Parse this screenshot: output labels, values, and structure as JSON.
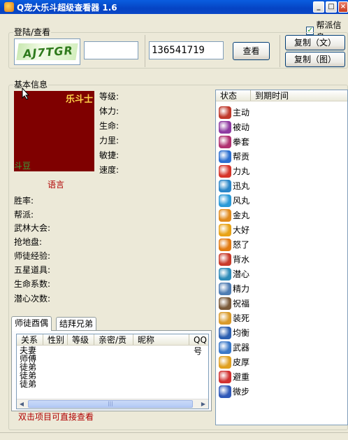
{
  "window": {
    "title": "Q宠大乐斗超级查看器 1.6",
    "min": "_",
    "max": "□",
    "close": "×"
  },
  "guild_toggle": {
    "label": "帮派信息",
    "checked": true
  },
  "login": {
    "group_title": "登陆/查看",
    "captcha_text": "AJ7TGR",
    "qq_input_value": "",
    "target_qq_value": "136541719",
    "view_button": "查看",
    "copy_text_button": "复制（文）",
    "copy_image_button": "复制（图）"
  },
  "basic": {
    "group_title": "基本信息",
    "class_name": "乐斗士",
    "avatar_corner": "斗豆",
    "language_link": "语言",
    "stats": [
      "等级:",
      "体力:",
      "生命:",
      "力里:",
      "敏捷:",
      "速度:"
    ],
    "info": [
      "胜率:",
      "帮派:",
      "武林大会:",
      "抢地盘:",
      "师徒经验:",
      "五星道具:",
      "生命系数:",
      "潜心次数:"
    ]
  },
  "status_list": {
    "headers": [
      "状态",
      "到期时间"
    ],
    "items": [
      {
        "label": "主动",
        "icon": "active-icon",
        "color": "#c0392b"
      },
      {
        "label": "被动",
        "icon": "passive-icon",
        "color": "#8e3aa1"
      },
      {
        "label": "拳套",
        "icon": "glove-icon",
        "color": "#b03070"
      },
      {
        "label": "帮贡",
        "icon": "guild-contribution-icon",
        "color": "#2b6fd0"
      },
      {
        "label": "力丸",
        "icon": "strength-pill-icon",
        "color": "#d6352a"
      },
      {
        "label": "迅丸",
        "icon": "speed-pill-icon",
        "color": "#2a86c8"
      },
      {
        "label": "风丸",
        "icon": "wind-pill-icon",
        "color": "#2a9ad8"
      },
      {
        "label": "金丸",
        "icon": "gold-pill-icon",
        "color": "#e08a1c"
      },
      {
        "label": "大好",
        "icon": "great-icon",
        "color": "#e8a317"
      },
      {
        "label": "怒了",
        "icon": "angry-icon",
        "color": "#e27b12"
      },
      {
        "label": "背水",
        "icon": "backwater-icon",
        "color": "#c83a2a"
      },
      {
        "label": "潜心",
        "icon": "meditate-icon",
        "color": "#2d8bb8"
      },
      {
        "label": "精力",
        "icon": "energy-icon",
        "color": "#4f7db3"
      },
      {
        "label": "祝福",
        "icon": "blessing-icon",
        "color": "#7a5a3a"
      },
      {
        "label": "装死",
        "icon": "play-dead-icon",
        "color": "#d99a2a"
      },
      {
        "label": "均衡",
        "icon": "balance-icon",
        "color": "#2c5fb0"
      },
      {
        "label": "武器",
        "icon": "weapon-icon",
        "color": "#3a78c8"
      },
      {
        "label": "皮厚",
        "icon": "thick-skin-icon",
        "color": "#e0a020"
      },
      {
        "label": "避重",
        "icon": "dodge-icon",
        "color": "#d03030"
      },
      {
        "label": "微步",
        "icon": "step-icon",
        "color": "#2f58b8"
      }
    ]
  },
  "relations": {
    "tabs": [
      "师徒酉偶",
      "结拜兄弟"
    ],
    "headers": [
      "关系",
      "性别",
      "等级",
      "亲密/贡",
      "昵称",
      "QQ号"
    ],
    "rows": [
      "夫妻",
      "师傅",
      "徒弟",
      "徒弟",
      "徒弟"
    ],
    "hint": "双击项目可直接查看"
  },
  "colors": {
    "accent_red": "#7f0000",
    "title_blue": "#0a4fcf",
    "link_red": "#b00000"
  }
}
